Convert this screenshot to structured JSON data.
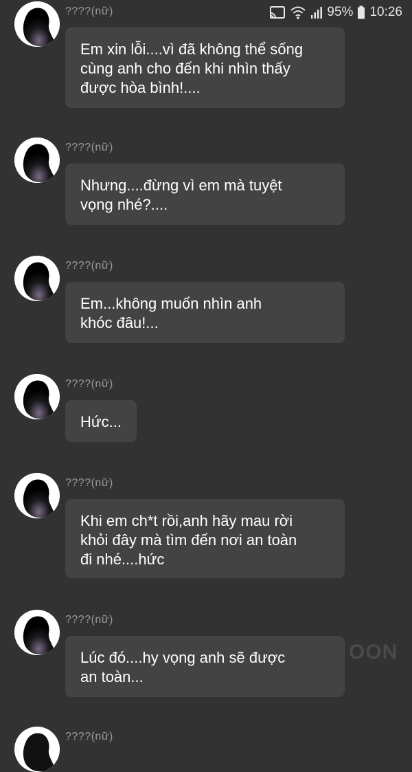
{
  "status_bar": {
    "battery_percent": "95%",
    "time": "10:26",
    "icons": [
      "cast-icon",
      "wifi-icon",
      "signal-icon",
      "battery-icon"
    ]
  },
  "messages": [
    {
      "sender": "????(nữ)",
      "text": "Em xin lỗi....vì đã không thể sống\ncùng anh cho đến khi nhìn thấy\nđược hòa bình!...."
    },
    {
      "sender": "????(nữ)",
      "text": "Nhưng....đừng vì em mà tuyệt\nvọng nhé?...."
    },
    {
      "sender": "????(nữ)",
      "text": "Em...không muốn nhìn anh\nkhóc đâu!..."
    },
    {
      "sender": "????(nữ)",
      "text": "Hức..."
    },
    {
      "sender": "????(nữ)",
      "text": "Khi em ch*t rồi,anh hãy mau rời\nkhỏi đây mà tìm đến nơi an toàn\nđi nhé....hức"
    },
    {
      "sender": "????(nữ)",
      "text": "Lúc đó....hy vọng anh sẽ được\nan toàn..."
    },
    {
      "sender": "????(nữ)",
      "text": ""
    }
  ],
  "watermark": "OON",
  "colors": {
    "background": "#323232",
    "bubble": "#434343",
    "text": "#ffffff",
    "sender": "#9a9a9a"
  }
}
